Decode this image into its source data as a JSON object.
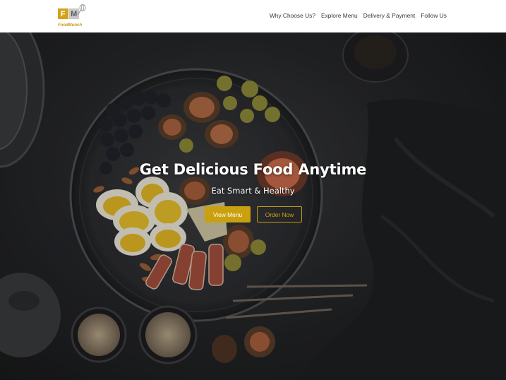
{
  "header": {
    "logo": {
      "letters": [
        "F",
        "M"
      ],
      "tagline": "FoodMunch"
    },
    "nav": [
      {
        "label": "Why Choose Us?"
      },
      {
        "label": "Explore Menu"
      },
      {
        "label": "Delivery & Payment"
      },
      {
        "label": "Follow Us"
      }
    ]
  },
  "hero": {
    "title": "Get Delicious Food Anytime",
    "subtitle": "Eat Smart & Healthy",
    "buttons": {
      "view_menu": "View Menu",
      "order_now": "Order Now"
    }
  },
  "colors": {
    "accent": "#d0a20f",
    "nav_text": "#3a3a3a",
    "hero_bg": "#262729"
  }
}
